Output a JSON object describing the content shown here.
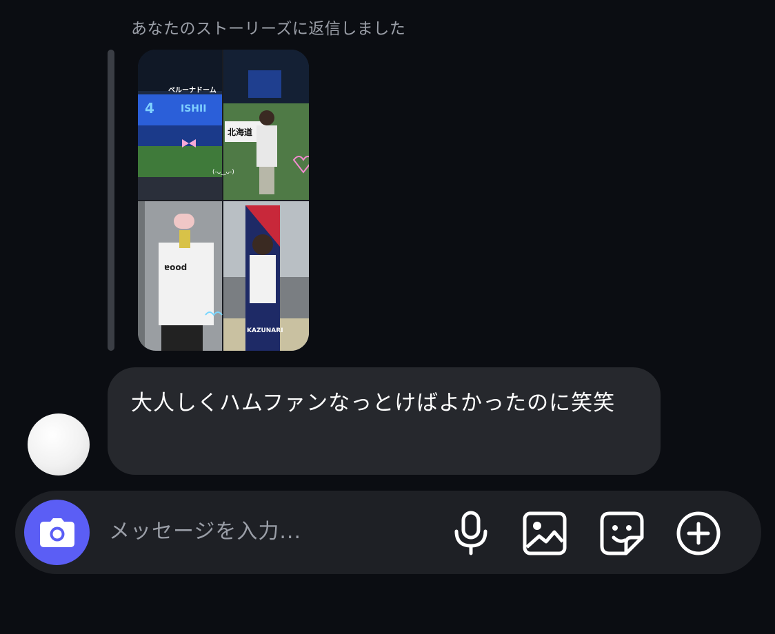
{
  "reply_header": "あなたのストーリーズに返信しました",
  "story_thumbnail": {
    "icon": "photo-collage",
    "overlay_text_1": "ベルーナドーム",
    "overlay_text_2": "北海道",
    "overlay_text_3": "ISHII",
    "overlay_text_4": "KAZUNARI",
    "overlay_text_5": "(-ᴗ‿ᴗ-)"
  },
  "message": {
    "text": "大人しくハムファンなっとけばよかったのに笑笑"
  },
  "composer": {
    "placeholder": "メッセージを入力...",
    "accent_color": "#5b5ef5",
    "icons": [
      "camera-icon",
      "microphone-icon",
      "gallery-icon",
      "sticker-icon",
      "plus-icon"
    ]
  }
}
